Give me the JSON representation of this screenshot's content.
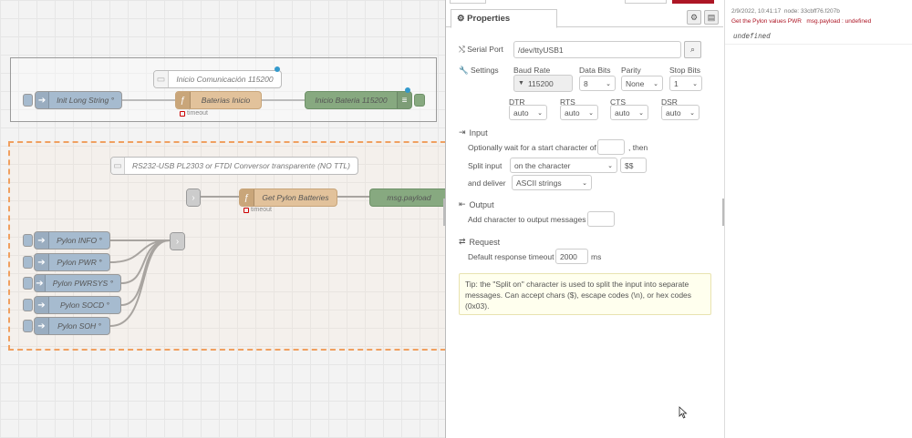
{
  "canvas": {
    "group1": {
      "comment": "Inicio Comunicación 115200",
      "inject": "Init Long String °",
      "func": "Baterias Inicio",
      "func_status": "timeout",
      "debug": "Inicio Bateria 115200"
    },
    "group2": {
      "comment": "RS232-USB PL2303 or FTDI Conversor transparente (NO TTL)",
      "func": "Get Pylon Batteries",
      "func_status": "timeout",
      "debug": "msg.payload",
      "injects": [
        "Pylon INFO °",
        "Pylon PWR °",
        "Pylon PWRSYS °",
        "Pylon SOCD °",
        "Pylon SOH °"
      ]
    }
  },
  "tray": {
    "tab_label": "Properties",
    "serial_port": {
      "label": "Serial Port",
      "value": "/dev/ttyUSB1"
    },
    "settings": {
      "label": "Settings",
      "baud_rate": {
        "label": "Baud Rate",
        "value": "115200"
      },
      "data_bits": {
        "label": "Data Bits",
        "value": "8"
      },
      "parity": {
        "label": "Parity",
        "value": "None"
      },
      "stop_bits": {
        "label": "Stop Bits",
        "value": "1"
      },
      "dtr": {
        "label": "DTR",
        "value": "auto"
      },
      "rts": {
        "label": "RTS",
        "value": "auto"
      },
      "cts": {
        "label": "CTS",
        "value": "auto"
      },
      "dsr": {
        "label": "DSR",
        "value": "auto"
      }
    },
    "input": {
      "title": "Input",
      "wait_text": "Optionally wait for a start character of",
      "wait_then": ", then",
      "split_label": "Split input",
      "split_value": "on the character",
      "split_char": "$$",
      "deliver_label": "and deliver",
      "deliver_value": "ASCII strings"
    },
    "output": {
      "title": "Output",
      "add_char_label": "Add character to output messages"
    },
    "request": {
      "title": "Request",
      "timeout_label": "Default response timeout",
      "timeout_value": "2000",
      "timeout_unit": "ms"
    },
    "tip": "Tip: the \"Split on\" character is used to split the input into separate messages. Can accept chars ($), escape codes (\\n), or hex codes (0x03)."
  },
  "debug": {
    "timestamp": "2/9/2022, 10:41:17",
    "node": "node: 33cbff76.f207b",
    "source": "Get the Pylon values PWR",
    "topic": "msg.payload : undefined",
    "value": "undefined"
  },
  "colors": {
    "accent_red": "#ad1625",
    "inject": "#a6bbcf",
    "function": "#e2c29b",
    "debug": "#87a980",
    "group_dashed": "#f0a060"
  }
}
